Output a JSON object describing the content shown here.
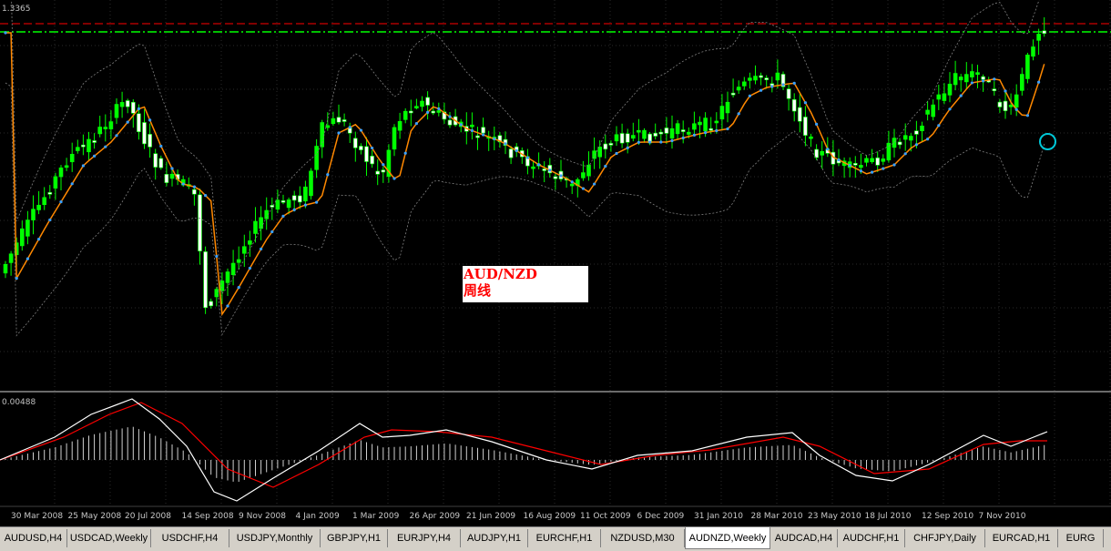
{
  "chart": {
    "price_scale_top_label": "1.3365",
    "indicator_scale_top_label": "0.00488",
    "annotation": {
      "line1": "AUD/NZD",
      "line2": "周线"
    },
    "colors": {
      "bull": "#00ff00",
      "bear": "#ffffff",
      "ma": "#ff8800",
      "ma_dots": "#3aa0ff",
      "bands": "#808080",
      "level_red": "#ff0000",
      "level_green": "#00c000",
      "macd": "#ffffff",
      "signal": "#ff0000",
      "circle": "#00c8d8"
    }
  },
  "time_axis": [
    "30 Mar 2008",
    "25 May 2008",
    "20 Jul 2008",
    "14 Sep 2008",
    "9 Nov 2008",
    "4 Jan 2009",
    "1 Mar 2009",
    "26 Apr 2009",
    "21 Jun 2009",
    "16 Aug 2009",
    "11 Oct 2009",
    "6 Dec 2009",
    "31 Jan 2010",
    "28 Mar 2010",
    "23 May 2010",
    "18 Jul 2010",
    "12 Sep 2010",
    "7 Nov 2010"
  ],
  "tabs": [
    {
      "label": "AUDUSD,H4",
      "active": false
    },
    {
      "label": "USDCAD,Weekly",
      "active": false
    },
    {
      "label": "USDCHF,H4",
      "active": false
    },
    {
      "label": "USDJPY,Monthly",
      "active": false
    },
    {
      "label": "GBPJPY,H1",
      "active": false
    },
    {
      "label": "EURJPY,H4",
      "active": false
    },
    {
      "label": "AUDJPY,H1",
      "active": false
    },
    {
      "label": "EURCHF,H1",
      "active": false
    },
    {
      "label": "NZDUSD,M30",
      "active": false
    },
    {
      "label": "AUDNZD,Weekly",
      "active": true
    },
    {
      "label": "AUDCAD,H4",
      "active": false
    },
    {
      "label": "AUDCHF,H1",
      "active": false
    },
    {
      "label": "CHFJPY,Daily",
      "active": false
    },
    {
      "label": "EURCAD,H1",
      "active": false
    },
    {
      "label": "EURG",
      "active": false
    }
  ]
}
